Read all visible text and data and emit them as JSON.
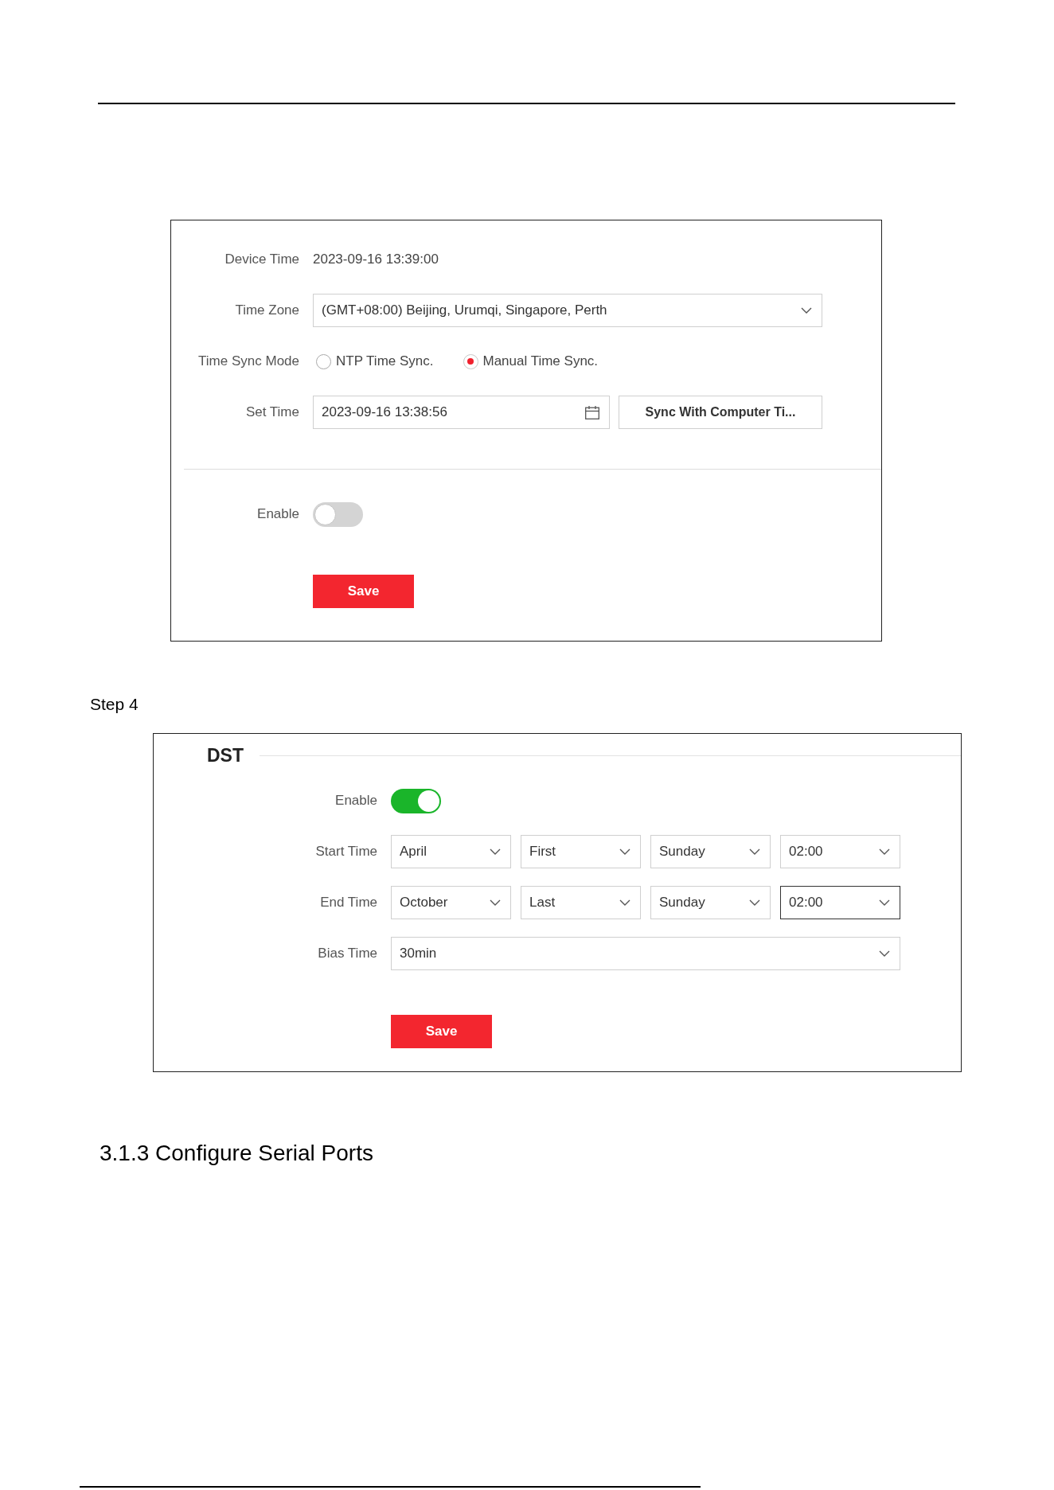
{
  "time_settings": {
    "device_time": {
      "label": "Device Time",
      "value": "2023-09-16 13:39:00"
    },
    "time_zone": {
      "label": "Time Zone",
      "value": "(GMT+08:00) Beijing, Urumqi, Singapore, Perth"
    },
    "time_sync_mode": {
      "label": "Time Sync Mode",
      "options": [
        {
          "label": "NTP Time Sync.",
          "selected": false
        },
        {
          "label": "Manual Time Sync.",
          "selected": true
        }
      ]
    },
    "set_time": {
      "label": "Set Time",
      "value": "2023-09-16 13:38:56",
      "button": "Sync With Computer Ti..."
    },
    "enable": {
      "label": "Enable",
      "on": false
    },
    "save_button": "Save"
  },
  "step_label": "Step 4",
  "dst": {
    "title": "DST",
    "enable": {
      "label": "Enable",
      "on": true
    },
    "time_rows": [
      {
        "label": "Start Time",
        "selects": [
          {
            "value": "April",
            "focused": false
          },
          {
            "value": "First",
            "focused": false
          },
          {
            "value": "Sunday",
            "focused": false
          },
          {
            "value": "02:00",
            "focused": false
          }
        ]
      },
      {
        "label": "End Time",
        "selects": [
          {
            "value": "October",
            "focused": false
          },
          {
            "value": "Last",
            "focused": false
          },
          {
            "value": "Sunday",
            "focused": false
          },
          {
            "value": "02:00",
            "focused": true
          }
        ]
      }
    ],
    "bias_time": {
      "label": "Bias Time",
      "value": "30min"
    },
    "save_button": "Save"
  },
  "section_heading": "3.1.3 Configure Serial Ports"
}
